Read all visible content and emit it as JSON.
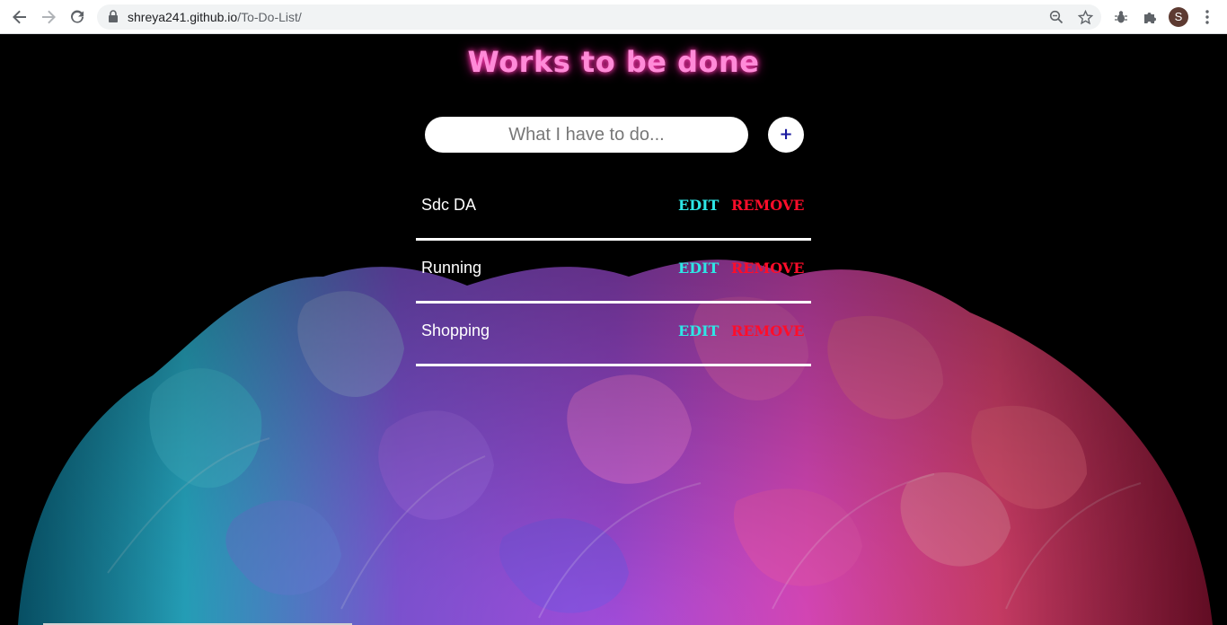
{
  "browser": {
    "url_host": "shreya241.github.io",
    "url_path": "/To-Do-List/",
    "profile_initial": "S"
  },
  "page": {
    "title": "Works to be done",
    "input_placeholder": "What I have to do...",
    "add_label": "+",
    "tasks": [
      {
        "text": "Sdc DA",
        "edit_label": "EDIT",
        "remove_label": "REMOVE"
      },
      {
        "text": "Running",
        "edit_label": "EDIT",
        "remove_label": "REMOVE"
      },
      {
        "text": "Shopping",
        "edit_label": "EDIT",
        "remove_label": "REMOVE"
      }
    ]
  },
  "colors": {
    "title": "#ff8ad8",
    "edit": "#2ee6e6",
    "remove": "#ff0d2a",
    "background": "#000000"
  }
}
